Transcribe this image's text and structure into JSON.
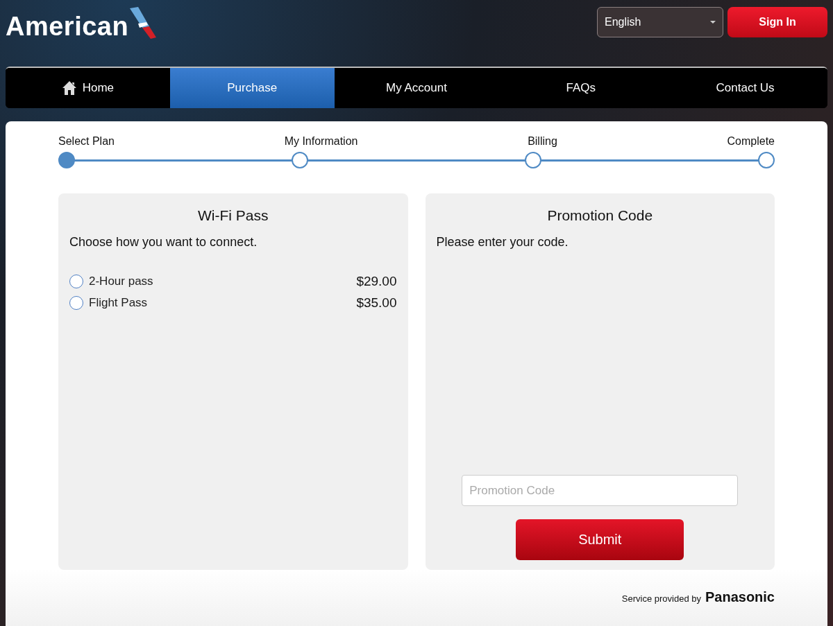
{
  "header": {
    "logo_text": "American",
    "language": {
      "value": "English"
    },
    "sign_in": "Sign In"
  },
  "nav": [
    {
      "label": "Home",
      "kind": "home",
      "selected": false
    },
    {
      "label": "Purchase",
      "kind": "plain",
      "selected": true
    },
    {
      "label": "My Account",
      "kind": "plain",
      "selected": false
    },
    {
      "label": "FAQs",
      "kind": "plain",
      "selected": false
    },
    {
      "label": "Contact Us",
      "kind": "plain",
      "selected": false
    }
  ],
  "steps": [
    {
      "label": "Select Plan",
      "selected": true
    },
    {
      "label": "My Information",
      "selected": false
    },
    {
      "label": "Billing",
      "selected": false
    },
    {
      "label": "Complete",
      "selected": false
    }
  ],
  "wifi_pass": {
    "title": "Wi-Fi Pass",
    "subtitle": "Choose how you want to connect.",
    "options": [
      {
        "label": "2-Hour pass",
        "price": "$29.00",
        "selected": false
      },
      {
        "label": "Flight Pass",
        "price": "$35.00",
        "selected": false
      }
    ]
  },
  "promotion": {
    "title": "Promotion Code",
    "subtitle": "Please enter your code.",
    "field": {
      "placeholder": "Promotion Code"
    },
    "submit": "Submit"
  },
  "footer": {
    "text": "Service provided by",
    "brand": "Panasonic"
  }
}
